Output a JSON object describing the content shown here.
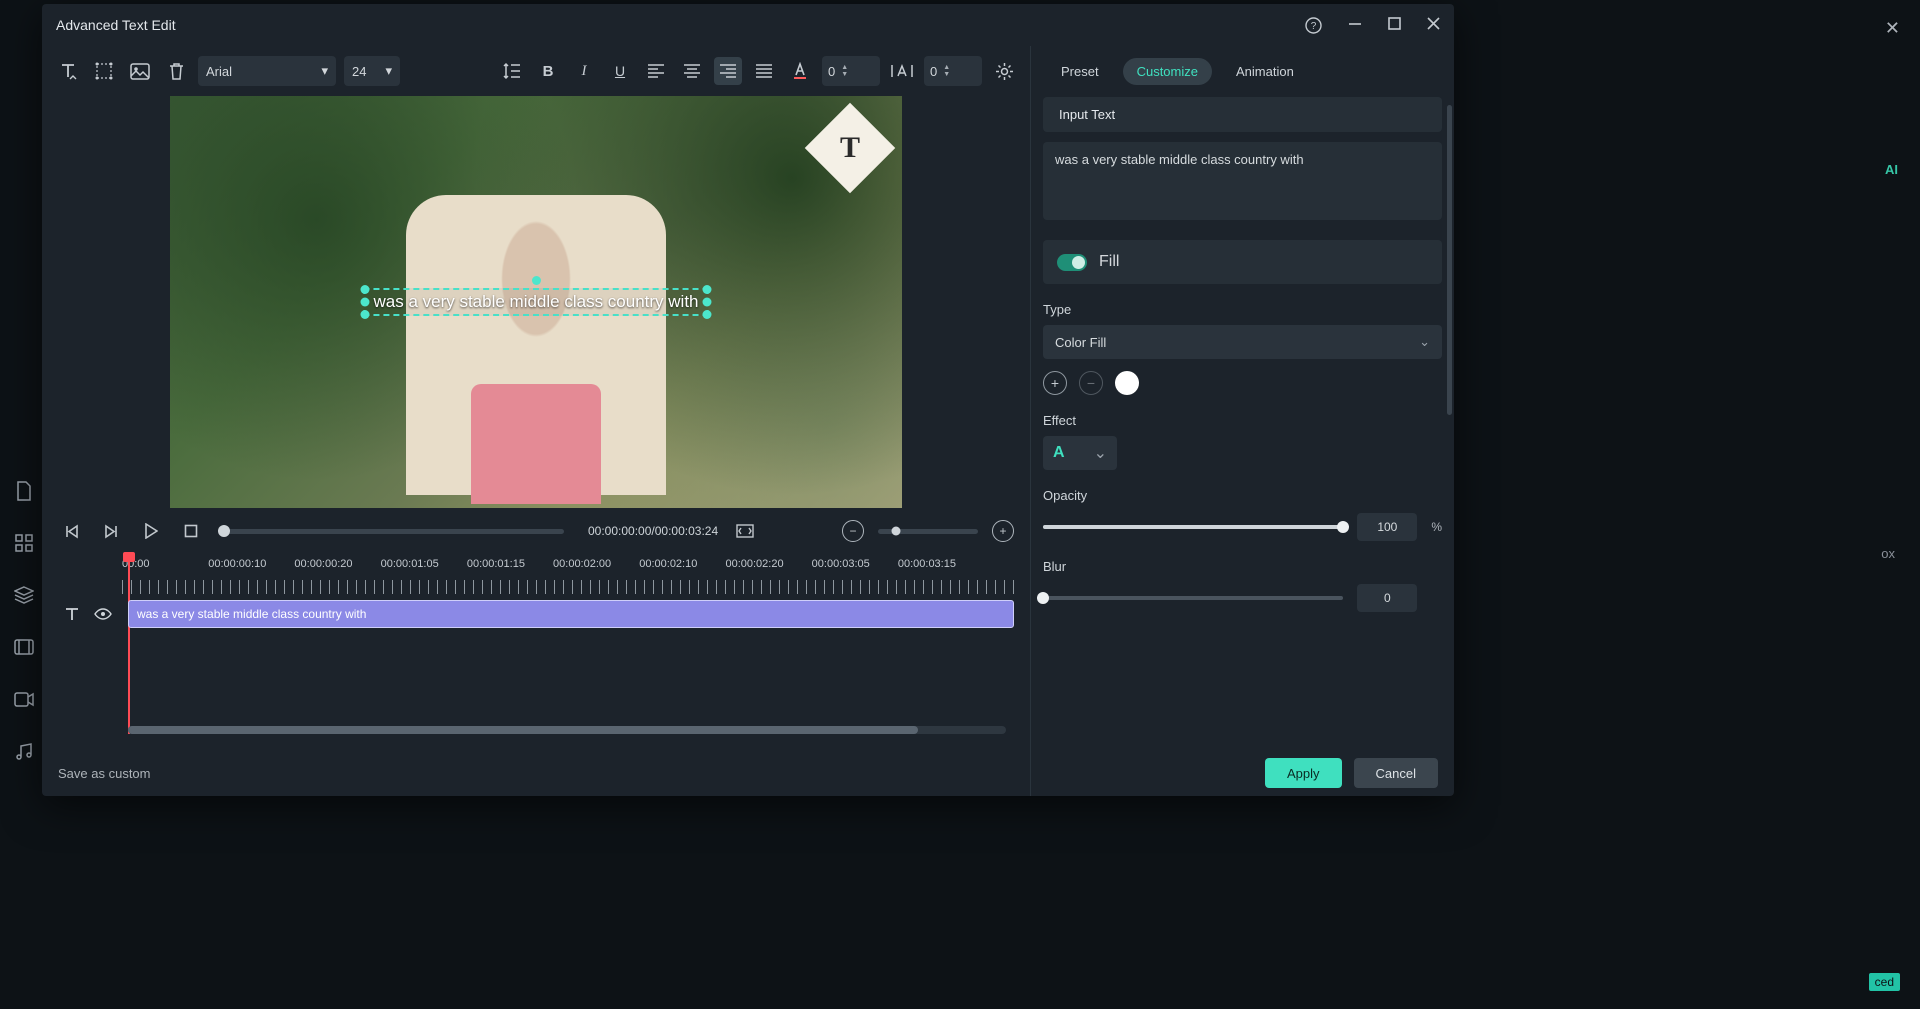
{
  "window": {
    "title": "Advanced Text Edit"
  },
  "toolbar": {
    "font": "Arial",
    "font_size": "24",
    "char_spacing": "0",
    "line_spacing": "0"
  },
  "preview": {
    "overlay_text": "was a very stable middle class country with",
    "logo_letter": "T"
  },
  "transport": {
    "time_display": "00:00:00:00/00:00:03:24"
  },
  "ruler": {
    "labels": [
      "00:00",
      "00:00:00:10",
      "00:00:00:20",
      "00:00:01:05",
      "00:00:01:15",
      "00:00:02:00",
      "00:00:02:10",
      "00:00:02:20",
      "00:00:03:05",
      "00:00:03:15"
    ]
  },
  "clip": {
    "text": "was a very stable middle class country with"
  },
  "footer": {
    "save": "Save as custom",
    "apply": "Apply",
    "cancel": "Cancel"
  },
  "tabs": {
    "preset": "Preset",
    "customize": "Customize",
    "animation": "Animation"
  },
  "right": {
    "input_text_label": "Input Text",
    "input_text_value": "was a very stable middle class country with",
    "fill_label": "Fill",
    "type_label": "Type",
    "type_value": "Color Fill",
    "effect_label": "Effect",
    "opacity_label": "Opacity",
    "opacity_value": "100",
    "opacity_unit": "%",
    "blur_label": "Blur",
    "blur_value": "0"
  },
  "bg": {
    "ox_label": "ox",
    "ced_label": "ced"
  }
}
